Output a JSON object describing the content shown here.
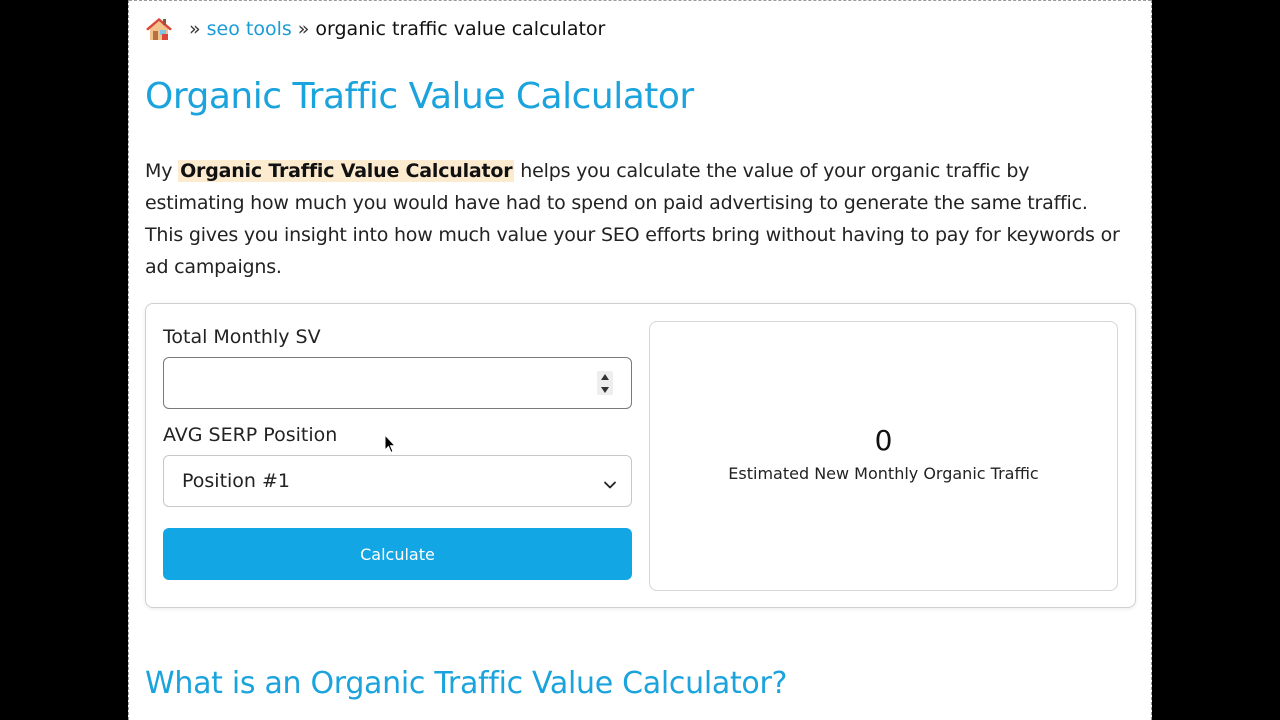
{
  "breadcrumb": {
    "separator": "»",
    "link_label": "seo tools",
    "current_label": "organic traffic value calculator"
  },
  "page_title": "Organic Traffic Value Calculator",
  "intro": {
    "prefix": "My ",
    "highlight": "Organic Traffic Value Calculator",
    "suffix": " helps you calculate the value of your organic traffic by estimating how much you would have had to spend on paid advertising to generate the same traffic. This gives you insight into how much value your SEO efforts bring without having to pay for keywords or ad campaigns."
  },
  "calculator": {
    "sv_label": "Total Monthly SV",
    "sv_value": "",
    "position_label": "AVG SERP Position",
    "position_selected": "Position #1",
    "calculate_label": "Calculate",
    "result_value": "0",
    "result_label": "Estimated New Monthly Organic Traffic"
  },
  "section_heading": "What is an Organic Traffic Value Calculator?",
  "colors": {
    "accent": "#1aa3dc",
    "button": "#12a6e4",
    "highlight": "#fdebd0"
  },
  "icons": {
    "home": "home-icon",
    "spinner_up": "chevron-up-icon",
    "spinner_down": "chevron-down-icon",
    "select": "chevron-down-icon",
    "cursor": "mouse-pointer-icon"
  }
}
